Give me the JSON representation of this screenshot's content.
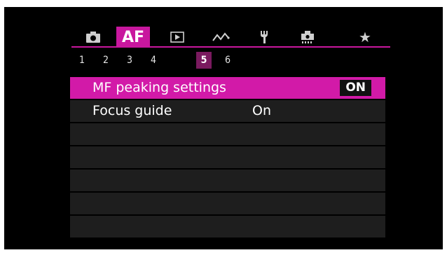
{
  "tabs": [
    {
      "id": "shoot",
      "icon": "camera-icon"
    },
    {
      "id": "af",
      "label": "AF",
      "active": true
    },
    {
      "id": "playback",
      "icon": "playback-icon"
    },
    {
      "id": "wireless",
      "icon": "wireless-icon"
    },
    {
      "id": "setup",
      "icon": "wrench-icon"
    },
    {
      "id": "custom",
      "icon": "custom-functions-icon"
    },
    {
      "id": "mymenu",
      "icon": "star-icon"
    }
  ],
  "pages": [
    "1",
    "2",
    "3",
    "4",
    "5",
    "6"
  ],
  "active_page": "5",
  "menu": {
    "items": [
      {
        "label": "MF peaking settings",
        "value": "ON"
      },
      {
        "label": "Focus guide",
        "value": "On"
      }
    ]
  },
  "colors": {
    "accent": "#c8179e",
    "selected_row": "#d21aa8",
    "active_page": "#7a1a5f",
    "row_bg": "#1e1e1e"
  }
}
